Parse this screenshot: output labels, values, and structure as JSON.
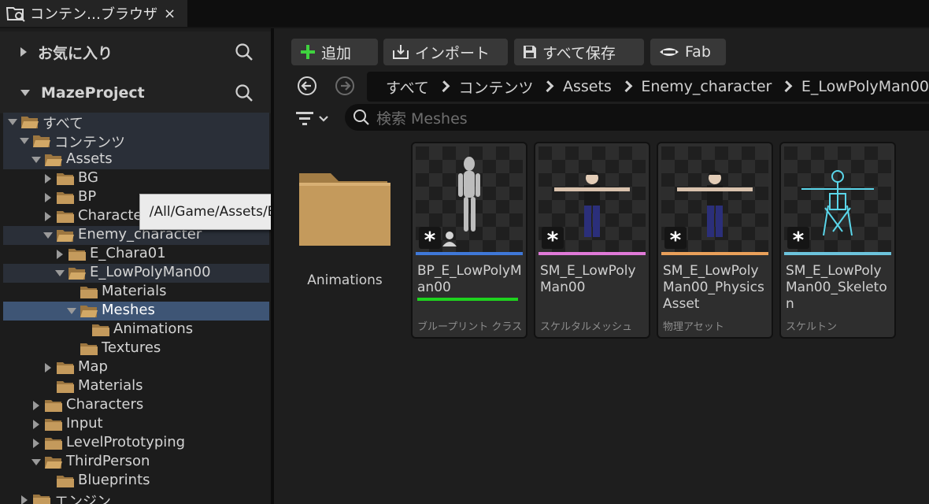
{
  "tab": {
    "title": "コンテン…ブラウザ",
    "close": "×"
  },
  "left": {
    "favorites_label": "お気に入り",
    "project_label": "MazeProject",
    "tree": [
      {
        "label": "すべて"
      },
      {
        "label": "コンテンツ"
      },
      {
        "label": "Assets"
      },
      {
        "label": "BG"
      },
      {
        "label": "BP"
      },
      {
        "label": "Characte"
      },
      {
        "label": "Enemy_character"
      },
      {
        "label": "E_Chara01"
      },
      {
        "label": "E_LowPolyMan00"
      },
      {
        "label": "Materials"
      },
      {
        "label": "Meshes"
      },
      {
        "label": "Animations"
      },
      {
        "label": "Textures"
      },
      {
        "label": "Map"
      },
      {
        "label": "Materials"
      },
      {
        "label": "Characters"
      },
      {
        "label": "Input"
      },
      {
        "label": "LevelPrototyping"
      },
      {
        "label": "ThirdPerson"
      },
      {
        "label": "Blueprints"
      },
      {
        "label": "エンジン"
      }
    ],
    "tooltip": "/All/Game/Assets/BG"
  },
  "toolbar": {
    "add": "追加",
    "import": "インポート",
    "save_all": "すべて保存",
    "fab": "Fab"
  },
  "breadcrumbs": [
    "すべて",
    "コンテンツ",
    "Assets",
    "Enemy_character",
    "E_LowPolyMan00"
  ],
  "search": {
    "placeholder": "検索 Meshes"
  },
  "folder_item": {
    "name": "Animations"
  },
  "assets": [
    {
      "name": "BP_E_LowPolyMan00",
      "type": "ブループリント クラス",
      "color": "#3f78d8",
      "badge": "*"
    },
    {
      "name": "SM_E_LowPolyMan00",
      "type": "スケルタルメッシュ",
      "color": "#e07ad8",
      "badge": "*"
    },
    {
      "name": "SM_E_LowPolyMan00_PhysicsAsset",
      "type": "物理アセット",
      "color": "#e9a05a",
      "badge": "*"
    },
    {
      "name": "SM_E_LowPolyMan00_Skeleton",
      "type": "スケルトン",
      "color": "#6cc3dc",
      "badge": "*"
    }
  ]
}
